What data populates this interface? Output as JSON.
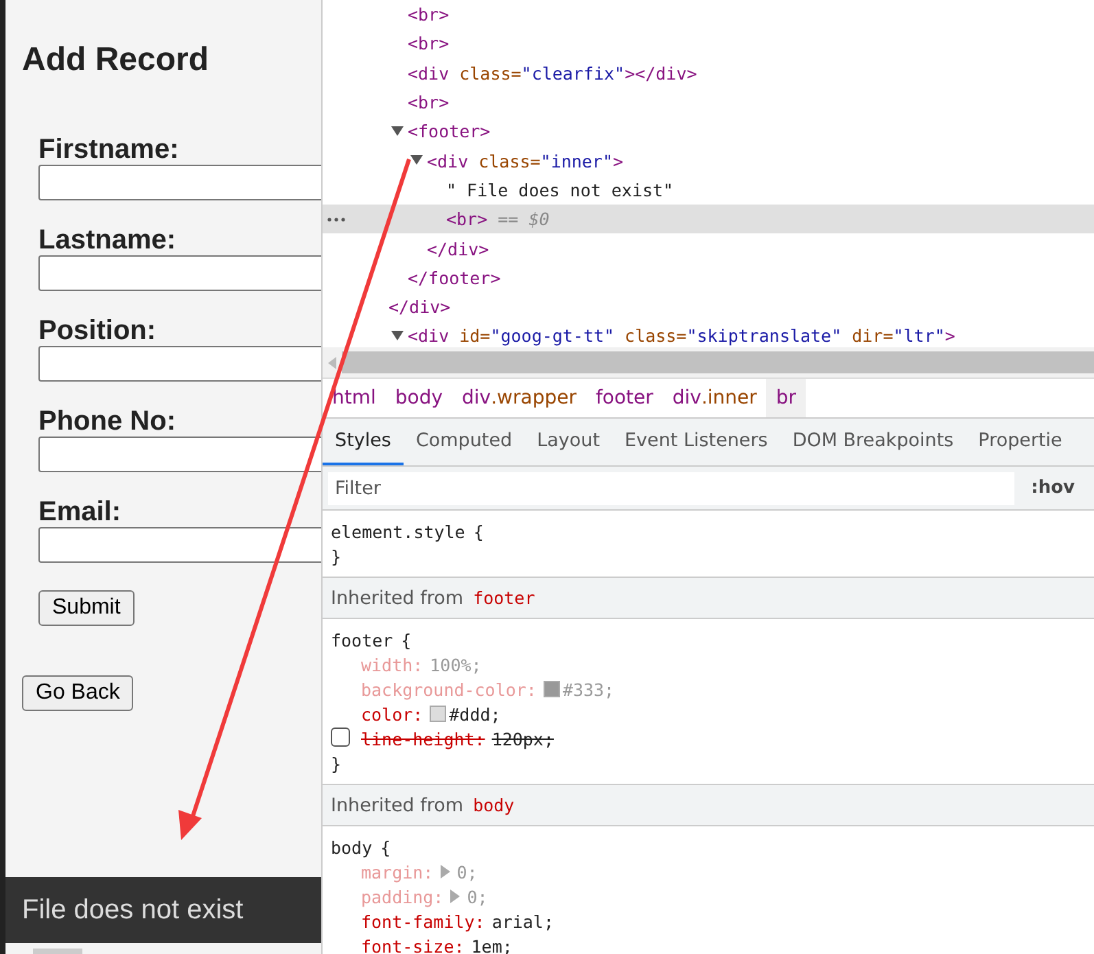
{
  "page": {
    "title": "Add Record",
    "fields": [
      {
        "label": "Firstname:"
      },
      {
        "label": "Lastname:"
      },
      {
        "label": "Position:"
      },
      {
        "label": "Phone No:"
      },
      {
        "label": "Email:"
      }
    ],
    "submit_button": "Submit",
    "back_button": "Go Back",
    "footer_text": "File does not exist"
  },
  "devtools": {
    "dom_tree": [
      {
        "children": [
          {
            "open": [
              {
                "kind": "tag",
                "t": "<br>"
              }
            ]
          },
          {
            "open": [
              {
                "kind": "tag",
                "t": "<br>"
              }
            ]
          },
          {
            "open": [
              {
                "kind": "tag",
                "t": "<div"
              },
              {
                "kind": "attr",
                "t": " class="
              },
              {
                "kind": "value",
                "t": "\"clearfix\""
              },
              {
                "kind": "tag",
                "t": "></div>"
              }
            ]
          },
          {
            "open": [
              {
                "kind": "tag",
                "t": "<br>"
              }
            ]
          },
          {
            "open": [
              {
                "kind": "tag",
                "t": "<footer>"
              }
            ],
            "expanded": true,
            "children": [
              {
                "open": [
                  {
                    "kind": "tag",
                    "t": "<div"
                  },
                  {
                    "kind": "attr",
                    "t": " class="
                  },
                  {
                    "kind": "value",
                    "t": "\"inner\""
                  },
                  {
                    "kind": "tag",
                    "t": ">"
                  }
                ],
                "expanded": true,
                "children": [
                  {
                    "open": [
                      {
                        "kind": "text",
                        "t": "\" File does not exist\""
                      }
                    ],
                    "selected": false
                  },
                  {
                    "open": [
                      {
                        "kind": "tag",
                        "t": "<br>"
                      },
                      {
                        "kind": "hint",
                        "t": " == $0"
                      }
                    ],
                    "selected": true
                  }
                ],
                "close": [
                  {
                    "kind": "tag",
                    "t": "</div>"
                  }
                ]
              }
            ],
            "close": [
              {
                "kind": "tag",
                "t": "</footer>"
              }
            ]
          }
        ],
        "close": [
          {
            "kind": "tag",
            "t": "</div>"
          }
        ]
      },
      {
        "open": [
          {
            "kind": "tag",
            "t": "<div"
          },
          {
            "kind": "attr",
            "t": " id="
          },
          {
            "kind": "value",
            "t": "\"goog-gt-tt\""
          },
          {
            "kind": "attr",
            "t": " class="
          },
          {
            "kind": "value",
            "t": "\"skiptranslate\""
          },
          {
            "kind": "attr",
            "t": " dir="
          },
          {
            "kind": "value",
            "t": "\"ltr\""
          },
          {
            "kind": "tag",
            "t": ">"
          }
        ],
        "expanded": true
      }
    ],
    "breadcrumbs": [
      {
        "tag": "html",
        "selected": false
      },
      {
        "tag": "body",
        "selected": false
      },
      {
        "tag": "div",
        "cls": ".wrapper",
        "selected": false
      },
      {
        "tag": "footer",
        "selected": false
      },
      {
        "tag": "div",
        "cls": ".inner",
        "selected": false
      },
      {
        "tag": "br",
        "selected": true
      }
    ],
    "tabs": [
      {
        "label": "Styles",
        "selected": true
      },
      {
        "label": "Computed",
        "selected": false
      },
      {
        "label": "Layout",
        "selected": false
      },
      {
        "label": "Event Listeners",
        "selected": false
      },
      {
        "label": "DOM Breakpoints",
        "selected": false
      },
      {
        "label": "Propertie",
        "selected": false
      }
    ],
    "filter": {
      "placeholder": "Filter"
    },
    "hov_button": ":hov",
    "sections": [
      {
        "kind": "rule",
        "selector": "element.style",
        "open_brace": "{",
        "close_brace": "}"
      },
      {
        "kind": "inherited",
        "label": "Inherited from",
        "source": "footer"
      },
      {
        "kind": "rule",
        "selector": "footer",
        "open_brace": "{",
        "close_brace": "}",
        "properties": [
          {
            "name": "width:",
            "value": "100%;",
            "kind": "inactive"
          },
          {
            "name": "background-color:",
            "value": "#333;",
            "kind": "inactive",
            "color": "#999999"
          },
          {
            "name": "color:",
            "value": "#ddd;",
            "kind": "active",
            "color": "#dddddd"
          },
          {
            "name": "line-height:",
            "value": "120px;",
            "kind": "overridden",
            "checked": false
          }
        ]
      },
      {
        "kind": "inherited",
        "label": "Inherited from",
        "source": "body"
      },
      {
        "kind": "rule",
        "selector": "body",
        "open_brace": "{",
        "properties": [
          {
            "name": "margin:",
            "value": "0;",
            "kind": "inactive",
            "expanded": false
          },
          {
            "name": "padding:",
            "value": "0;",
            "kind": "inactive",
            "expanded": false
          },
          {
            "name": "font-family:",
            "value": "arial;",
            "kind": "active"
          },
          {
            "name": "font-size:",
            "value": "1em;",
            "kind": "active"
          }
        ]
      }
    ]
  }
}
